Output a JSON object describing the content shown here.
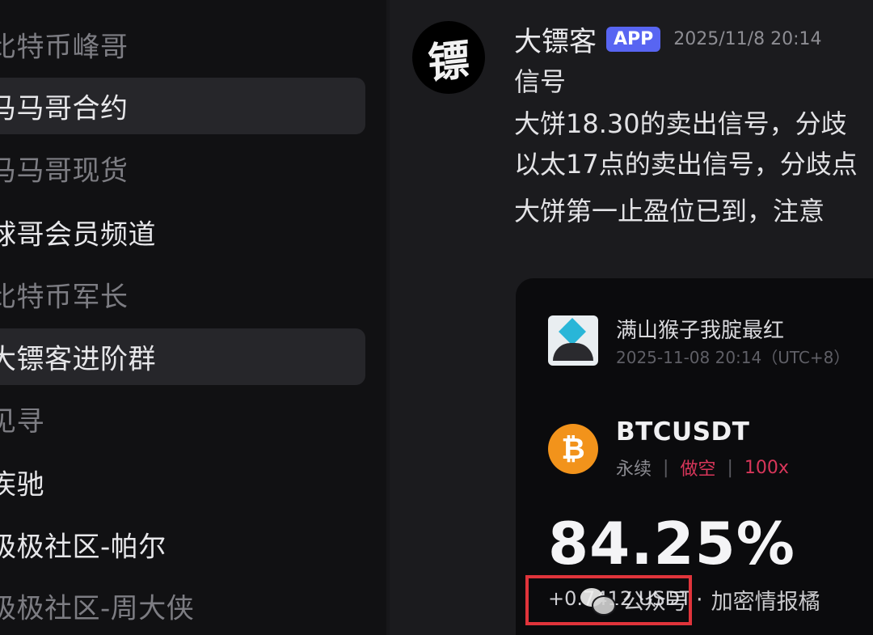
{
  "sidebar": {
    "items": [
      {
        "label": "比特币峰哥",
        "active": false,
        "dim": true
      },
      {
        "label": "马马哥合约",
        "active": true,
        "dim": false
      },
      {
        "label": "马马哥现货",
        "active": false,
        "dim": true
      },
      {
        "label": "球哥会员频道",
        "active": false,
        "dim": false
      },
      {
        "label": "比特币军长",
        "active": false,
        "dim": true
      },
      {
        "label": "大镖客进阶群",
        "active": true,
        "dim": false
      },
      {
        "label": "见寻",
        "active": false,
        "dim": true
      },
      {
        "label": "疾驰",
        "active": false,
        "dim": false
      },
      {
        "label": "极极社区-帕尔",
        "active": false,
        "dim": false
      },
      {
        "label": "极极社区-周大侠",
        "active": false,
        "dim": true
      }
    ]
  },
  "message": {
    "avatar_glyph": "镖",
    "author": "大镖客",
    "badge": "APP",
    "timestamp": "2025/11/8 20:14",
    "lines": [
      "信号",
      "大饼18.30的卖出信号，分歧",
      "以太17点的卖出信号，分歧点",
      "大饼第一止盈位已到，注意"
    ]
  },
  "card": {
    "username": "满山猴子我腚最红",
    "time": "2025-11-08 20:14（UTC+8）",
    "coin_icon": "₿",
    "pair": "BTCUSDT",
    "contract_type": "永续",
    "side": "做空",
    "leverage": "100x",
    "pnl_percent": "84.25%",
    "pnl_sub": "+0.7412 USDT"
  },
  "watermark": {
    "text_part1": "公众号",
    "dot": "·",
    "text_part2": "加密情报橘"
  },
  "colors": {
    "accent_badge": "#5865f2",
    "short_red": "#d8365a",
    "btc_orange": "#f2931b",
    "highlight_box": "#e0343b"
  }
}
